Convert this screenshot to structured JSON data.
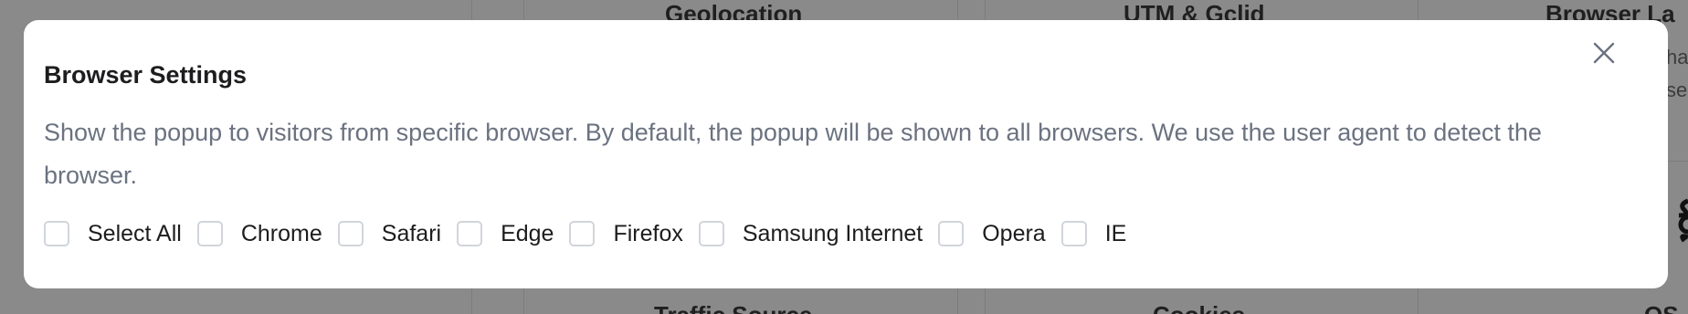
{
  "background": {
    "headings_top": [
      "Geolocation",
      "UTM & Gclid",
      "Browser La"
    ],
    "headings_bottom": [
      "Traffic Source",
      "Cookies",
      "OS"
    ],
    "right_snippets": [
      "ha",
      "se"
    ]
  },
  "modal": {
    "title": "Browser Settings",
    "description": "Show the popup to visitors from specific browser. By default, the popup will be shown to all browsers. We use the user agent to detect the browser.",
    "close_icon": "close-icon",
    "options": [
      {
        "label": "Select All",
        "checked": false
      },
      {
        "label": "Chrome",
        "checked": false
      },
      {
        "label": "Safari",
        "checked": false
      },
      {
        "label": "Edge",
        "checked": false
      },
      {
        "label": "Firefox",
        "checked": false
      },
      {
        "label": "Samsung Internet",
        "checked": false
      },
      {
        "label": "Opera",
        "checked": false
      },
      {
        "label": "IE",
        "checked": false
      }
    ]
  },
  "colors": {
    "overlay": "#8a8a8a",
    "modal_bg": "#ffffff",
    "title": "#1d1d1f",
    "description": "#6b7280",
    "checkbox_border": "#d1d5db"
  }
}
